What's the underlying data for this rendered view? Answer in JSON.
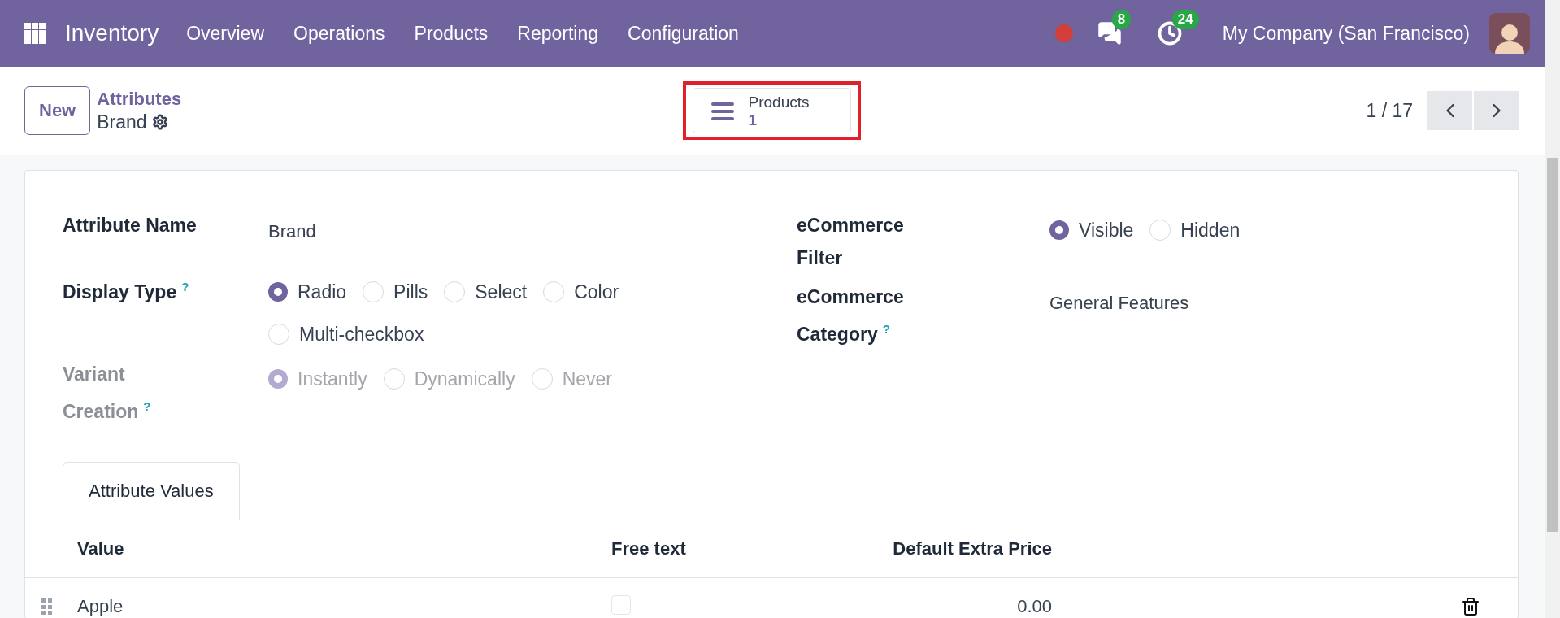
{
  "navbar": {
    "app_name": "Inventory",
    "menu": [
      "Overview",
      "Operations",
      "Products",
      "Reporting",
      "Configuration"
    ],
    "messages_count": "8",
    "activities_count": "24",
    "company": "My Company (San Francisco)"
  },
  "control_panel": {
    "new_button": "New",
    "breadcrumb_parent": "Attributes",
    "record_name": "Brand",
    "smart_button": {
      "label": "Products",
      "count": "1"
    },
    "pager": "1 / 17"
  },
  "form": {
    "left": [
      {
        "kind": "text",
        "label": "Attribute Name",
        "value": "Brand"
      },
      {
        "kind": "radio",
        "label": "Display Type",
        "help": "?",
        "disabled": false,
        "options": [
          {
            "label": "Radio",
            "selected": true
          },
          {
            "label": "Pills",
            "selected": false
          },
          {
            "label": "Select",
            "selected": false
          },
          {
            "label": "Color",
            "selected": false
          },
          {
            "label": "Multi-checkbox",
            "selected": false
          }
        ]
      },
      {
        "kind": "radio",
        "label": "Variant Creation",
        "help": "?",
        "disabled": true,
        "options": [
          {
            "label": "Instantly",
            "selected": true
          },
          {
            "label": "Dynamically",
            "selected": false
          },
          {
            "label": "Never",
            "selected": false
          }
        ]
      }
    ],
    "right": [
      {
        "kind": "radio",
        "label": "eCommerce Filter",
        "disabled": false,
        "options": [
          {
            "label": "Visible",
            "selected": true
          },
          {
            "label": "Hidden",
            "selected": false
          }
        ]
      },
      {
        "kind": "text",
        "label": "eCommerce Category",
        "help": "?",
        "value": "General Features"
      }
    ]
  },
  "tabs": [
    {
      "label": "Attribute Values",
      "selected": true
    }
  ],
  "table": {
    "columns": [
      "Value",
      "Free text",
      "Default Extra Price"
    ],
    "rows": [
      {
        "value": "Apple",
        "free_text": false,
        "extra_price": "0.00"
      }
    ]
  }
}
